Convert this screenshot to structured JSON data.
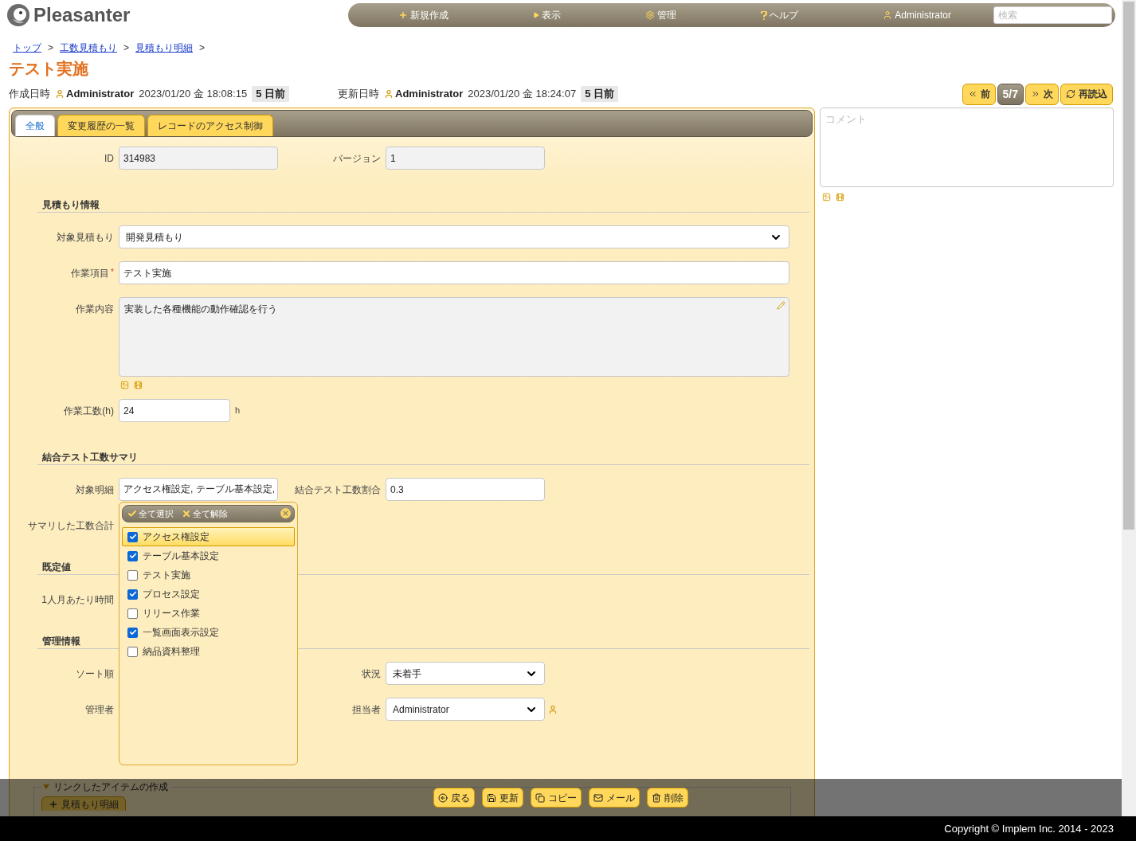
{
  "header": {
    "logo": "Pleasanter",
    "nav": [
      {
        "kind": "new",
        "label": "新規作成"
      },
      {
        "kind": "view",
        "label": "表示"
      },
      {
        "kind": "manage",
        "label": "管理"
      },
      {
        "kind": "help",
        "label": "ヘルプ"
      },
      {
        "kind": "user",
        "label": "Administrator"
      }
    ],
    "search": {
      "placeholder": "検索"
    }
  },
  "breadcrumb": {
    "items": [
      "トップ",
      "工数見積もり",
      "見積もり明細"
    ],
    "separator": ">"
  },
  "required_mark": "*",
  "title": "テスト実施",
  "meta": [
    {
      "label": "作成日時",
      "user": "Administrator",
      "datetime": "2023/01/20 金 18:08:15",
      "ago": "5 日前"
    },
    {
      "label": "更新日時",
      "user": "Administrator",
      "datetime": "2023/01/20 金 18:24:07",
      "ago": "5 日前"
    }
  ],
  "pager": {
    "prev": "前",
    "position": "5/7",
    "next": "次",
    "reload": "再読込"
  },
  "tabs": [
    {
      "label": "全般",
      "selected": true
    },
    {
      "label": "変更履歴の一覧",
      "selected": false
    },
    {
      "label": "レコードのアクセス制御",
      "selected": false
    }
  ],
  "top_row": [
    {
      "label": "ID",
      "kind": "readonly",
      "value": "314983"
    },
    {
      "label": "バージョン",
      "kind": "readonly",
      "value": "1"
    }
  ],
  "sections": [
    {
      "title": "見積もり情報",
      "rows": [
        [
          {
            "label": "対象見積もり",
            "kind": "combo",
            "value": "開発見積もり"
          }
        ],
        [
          {
            "label": "作業項目",
            "kind": "line",
            "value": "テスト実施",
            "required": true
          }
        ],
        [
          {
            "label": "作業内容",
            "kind": "memo",
            "value": "実装した各種機能の動作確認を行う"
          }
        ],
        [
          {
            "label": "作業工数(h)",
            "kind": "text",
            "value": "24",
            "suffix": "h"
          }
        ]
      ]
    },
    {
      "title": "結合テスト工数サマリ",
      "rows": [
        [
          {
            "label": "対象明細",
            "kind": "multi",
            "value": "アクセス権設定, テーブル基本設定,"
          },
          {
            "label": "結合テスト工数割合",
            "kind": "text",
            "value": "0.3"
          }
        ],
        [
          {
            "label": "サマリした工数合計",
            "kind": "empty"
          }
        ]
      ]
    },
    {
      "title": "既定値",
      "rows": [
        [
          {
            "label": "1人月あたり時間",
            "kind": "empty"
          }
        ]
      ]
    },
    {
      "title": "管理情報",
      "rows": [
        [
          {
            "label": "ソート順",
            "kind": "empty"
          },
          {
            "label": "状況",
            "kind": "select",
            "value": "未着手"
          }
        ],
        [
          {
            "label": "管理者",
            "kind": "empty"
          },
          {
            "label": "担当者",
            "kind": "userselect",
            "value": "Administrator"
          }
        ]
      ]
    }
  ],
  "multi_popup": {
    "select_all": "全て選択",
    "clear_all": "全て解除",
    "options": [
      {
        "label": "アクセス権設定",
        "checked": true,
        "selected": true
      },
      {
        "label": "テーブル基本設定",
        "checked": true,
        "selected": false
      },
      {
        "label": "テスト実施",
        "checked": false,
        "selected": false
      },
      {
        "label": "プロセス設定",
        "checked": true,
        "selected": false
      },
      {
        "label": "リリース作業",
        "checked": false,
        "selected": false
      },
      {
        "label": "一覧画面表示設定",
        "checked": true,
        "selected": false
      },
      {
        "label": "納品資料整理",
        "checked": false,
        "selected": false
      }
    ]
  },
  "links": {
    "legend": "リンクしたアイテムの作成",
    "expanded": true,
    "buttons": [
      "見積もり明細"
    ]
  },
  "comment": {
    "placeholder": "コメント"
  },
  "actions": [
    {
      "kind": "back",
      "label": "戻る"
    },
    {
      "kind": "update",
      "label": "更新"
    },
    {
      "kind": "copy",
      "label": "コピー"
    },
    {
      "kind": "mail",
      "label": "メール"
    },
    {
      "kind": "delete",
      "label": "削除"
    }
  ],
  "copyright": "Copyright © Implem Inc. 2014 - 2023"
}
